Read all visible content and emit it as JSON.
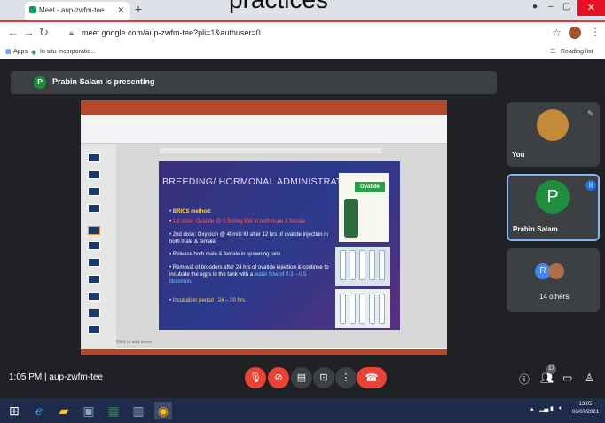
{
  "overlay": {
    "caption": "practices"
  },
  "browser": {
    "tab_title": "Meet - aup-zwfm-tee",
    "tab_close": "✕",
    "new_tab": "+",
    "url": "meet.google.com/aup-zwfm-tee?pli=1&authuser=0",
    "bookmarks": [
      "Apps",
      "In situ incorporatio..."
    ],
    "reading_list": "Reading list",
    "win_min": "–",
    "win_max": "▢",
    "win_close": "✕"
  },
  "meet": {
    "presenter_initial": "P",
    "presenter_text": "Prabin Salam is presenting",
    "meeting_time": "1:05 PM",
    "meeting_separator": "|",
    "meeting_code": "aup-zwfm-tee",
    "participants": [
      {
        "name": "You"
      },
      {
        "name": "Prabin Salam",
        "initial": "P"
      },
      {
        "name": "14 others",
        "initial": "R"
      }
    ],
    "people_count": "17"
  },
  "slide": {
    "title": "BREEDING/ HORMONAL ADMINISTRATION",
    "method": "BRICS method:",
    "bullet1": "1st dose: Ovatide @ 0.5ml/kg BW in both male & female",
    "bullet2": "2nd dose: Oxytocin @ 40milli IU after 12 hrs of ovatide injection in both male & female.",
    "bullet3": "Release both male & female in spawning tank",
    "bullet4_a": "Removal of brooders after 24 hrs of ovatide injection & continue to incubate the eggs in the tank with a",
    "bullet4_water": "water flow of 0.3 – 0.5 litres/min.",
    "bullet5": "Incubation period : 24 – 30 hrs.",
    "product_label": "Ovatide",
    "notes_placeholder": "Click to add notes"
  },
  "taskbar": {
    "clock_time": "13:05",
    "clock_date": "06/07/2021"
  },
  "colors": {
    "meet_bg": "#202124",
    "tile_bg": "#3c4043",
    "accent_red": "#ea4335",
    "presenter_green": "#1e8e3e",
    "ppt_red": "#b7472a"
  }
}
